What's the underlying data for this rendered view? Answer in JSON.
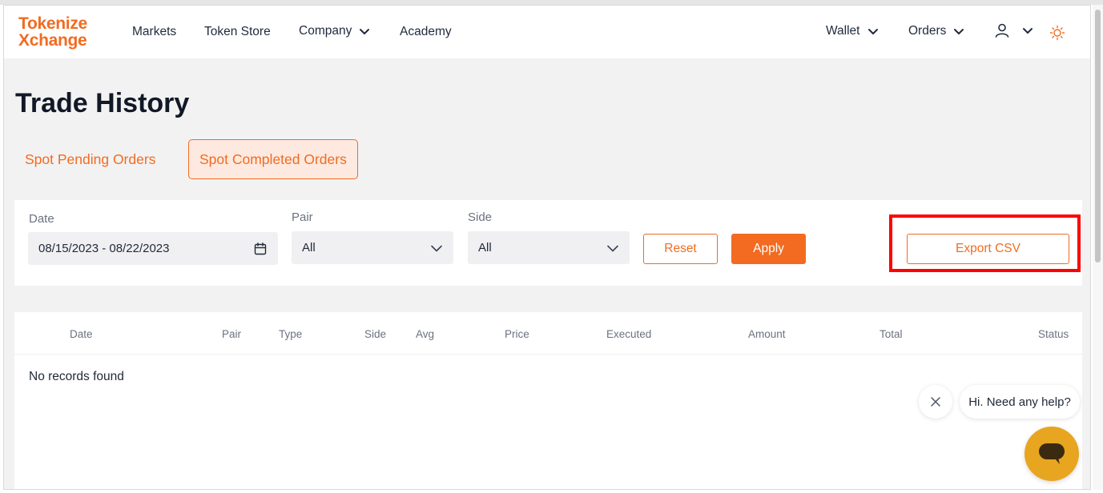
{
  "header": {
    "logo_line1": "Tokenize",
    "logo_line2": "Xchange",
    "nav": {
      "markets": "Markets",
      "token_store": "Token Store",
      "company": "Company",
      "academy": "Academy",
      "wallet": "Wallet",
      "orders": "Orders"
    },
    "icons": [
      "chevron-down-icon",
      "user-icon",
      "sun-icon"
    ],
    "accent_color": "#f26b21"
  },
  "page": {
    "title": "Trade History"
  },
  "tabs": [
    {
      "label": "Spot Pending Orders",
      "active": false
    },
    {
      "label": "Spot Completed Orders",
      "active": true
    }
  ],
  "filters": {
    "date": {
      "label": "Date",
      "value": "08/15/2023 - 08/22/2023",
      "icon": "calendar-icon"
    },
    "pair": {
      "label": "Pair",
      "value": "All"
    },
    "side": {
      "label": "Side",
      "value": "All"
    },
    "reset_label": "Reset",
    "apply_label": "Apply",
    "export_label": "Export CSV"
  },
  "table": {
    "columns": [
      "Date",
      "Pair",
      "Type",
      "Side",
      "Avg",
      "Price",
      "Executed",
      "Amount",
      "Total",
      "Status"
    ],
    "empty_text": "No records found"
  },
  "chat": {
    "greeting": "Hi. Need any help?",
    "launcher_color": "#e8a520"
  }
}
